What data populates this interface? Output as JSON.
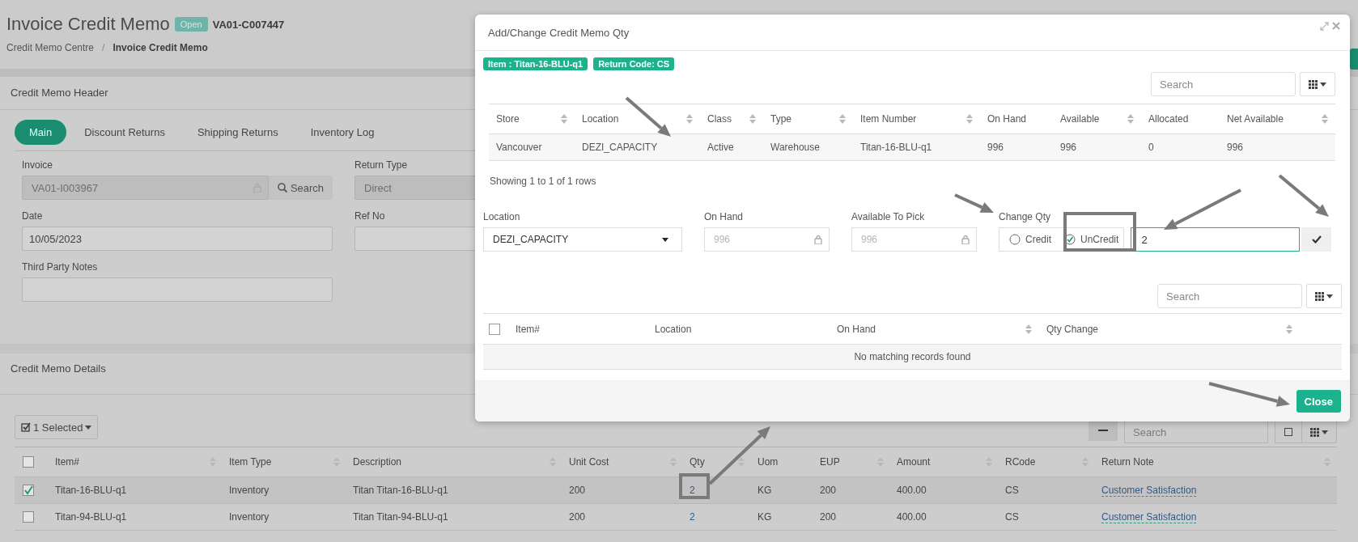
{
  "page": {
    "title": "Invoice Credit Memo",
    "status": "Open",
    "number": "VA01-C007447",
    "breadcrumb_separator": "/",
    "breadcrumb": [
      {
        "label": "Credit Memo Centre",
        "current": false
      },
      {
        "label": "Invoice Credit Memo",
        "current": true
      }
    ]
  },
  "header_card": {
    "title": "Credit Memo Header",
    "tabs": [
      {
        "label": "Main",
        "selected": true
      },
      {
        "label": "Discount Returns",
        "selected": false
      },
      {
        "label": "Shipping Returns",
        "selected": false
      },
      {
        "label": "Inventory Log",
        "selected": false
      }
    ],
    "fields": [
      {
        "label": "Invoice",
        "kind": "lookup",
        "value": "VA01-I003967",
        "disabled": true,
        "locked": true,
        "button": "Search"
      },
      {
        "label": "Return Type",
        "kind": "input",
        "value": "Direct",
        "disabled": true,
        "locked": false
      },
      {
        "label": "Date",
        "kind": "input",
        "value": "10/05/2023",
        "disabled": false,
        "locked": false
      },
      {
        "label": "Ref No",
        "kind": "input",
        "disabled": false,
        "locked": false
      },
      {
        "label": "Third Party Notes",
        "kind": "input",
        "disabled": false,
        "locked": false
      }
    ]
  },
  "details_card": {
    "title": "Credit Memo Details",
    "selection_button": "1 Selected",
    "search": {
      "placeholder": "Search"
    },
    "table": {
      "all_checked": false,
      "columns": [
        {
          "label": "Item#",
          "sortable": true,
          "kind": "text"
        },
        {
          "label": "Item Type",
          "sortable": true,
          "kind": "text"
        },
        {
          "label": "Description",
          "sortable": true,
          "kind": "text"
        },
        {
          "label": "Unit Cost",
          "sortable": true,
          "kind": "text"
        },
        {
          "label": "Qty",
          "sortable": true,
          "kind": "link"
        },
        {
          "label": "Uom",
          "sortable": false,
          "kind": "text"
        },
        {
          "label": "EUP",
          "sortable": true,
          "kind": "text"
        },
        {
          "label": "Amount",
          "sortable": true,
          "kind": "text"
        },
        {
          "label": "RCode",
          "sortable": true,
          "kind": "text"
        },
        {
          "label": "Return Note",
          "sortable": true,
          "kind": "note"
        }
      ],
      "rows": [
        {
          "selected": true,
          "cells": [
            "Titan-16-BLU-q1",
            "Inventory",
            "Titan Titan-16-BLU-q1",
            "200",
            "2",
            "KG",
            "200",
            "400.00",
            "CS",
            "Customer Satisfaction"
          ]
        },
        {
          "selected": false,
          "cells": [
            "Titan-94-BLU-q1",
            "Inventory",
            "Titan Titan-94-BLU-q1",
            "200",
            "2",
            "KG",
            "200",
            "400.00",
            "CS",
            "Customer Satisfaction"
          ]
        }
      ]
    }
  },
  "modal": {
    "title": "Add/Change Credit Memo Qty",
    "badges": [
      "Item : Titan-16-BLU-q1",
      "Return Code: CS"
    ],
    "stock_table": {
      "search": {
        "placeholder": "Search"
      },
      "columns": [
        {
          "label": "Store",
          "sortable": true
        },
        {
          "label": "Location",
          "sortable": true
        },
        {
          "label": "Class",
          "sortable": true
        },
        {
          "label": "Type",
          "sortable": true
        },
        {
          "label": "Item Number",
          "sortable": true
        },
        {
          "label": "On Hand",
          "sortable": false
        },
        {
          "label": "Available",
          "sortable": true
        },
        {
          "label": "Allocated",
          "sortable": false
        },
        {
          "label": "Net Available",
          "sortable": true
        }
      ],
      "rows": [
        [
          "Vancouver",
          "DEZI_CAPACITY",
          "Active",
          "Warehouse",
          "Titan-16-BLU-q1",
          "996",
          "996",
          "0",
          "996"
        ]
      ],
      "footer": "Showing 1 to 1 of 1 rows"
    },
    "form": {
      "location": {
        "label": "Location",
        "value": "DEZI_CAPACITY"
      },
      "on_hand": {
        "label": "On Hand",
        "value": "996",
        "disabled": true,
        "locked": true
      },
      "available": {
        "label": "Available To Pick",
        "value": "996",
        "disabled": true,
        "locked": true
      },
      "change_qty": {
        "label": "Change Qty",
        "options": [
          {
            "label": "Credit",
            "selected": false
          },
          {
            "label": "UnCredit",
            "selected": true
          }
        ],
        "value": "2"
      }
    },
    "changes_table": {
      "search": {
        "placeholder": "Search"
      },
      "all_checked": false,
      "columns": [
        {
          "label": "Item#",
          "sortable": false
        },
        {
          "label": "Location",
          "sortable": false
        },
        {
          "label": "On Hand",
          "sortable": true
        },
        {
          "label": "Qty Change",
          "sortable": true
        }
      ],
      "empty_message": "No matching records found"
    },
    "close_button": "Close"
  }
}
